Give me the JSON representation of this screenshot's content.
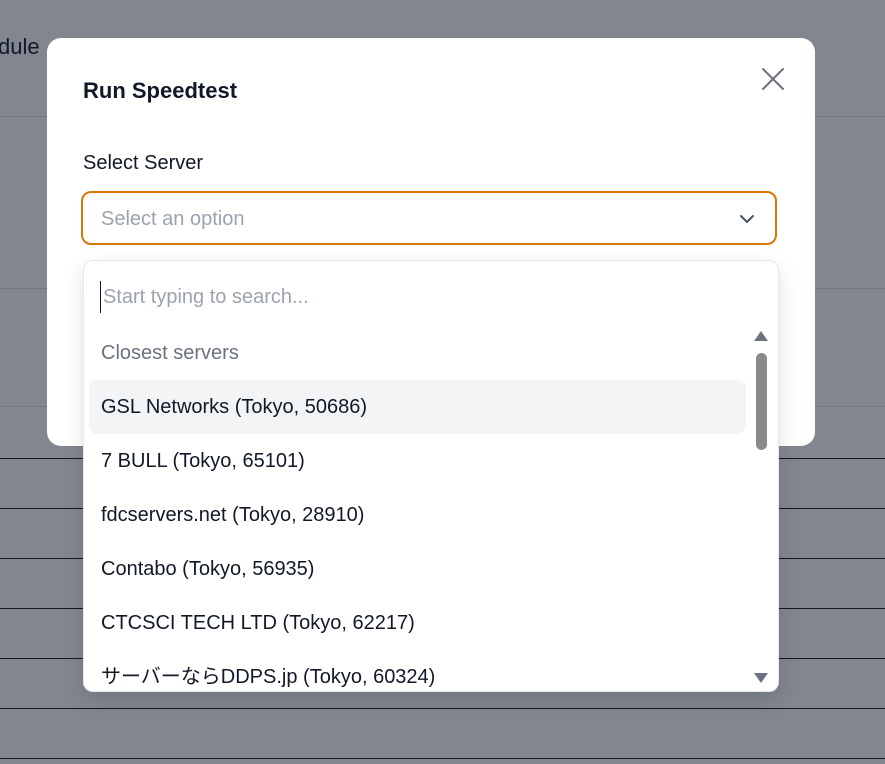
{
  "background": {
    "partial_heading": "dule"
  },
  "modal": {
    "title": "Run Speedtest",
    "close_icon": "close-icon",
    "field_label": "Select Server",
    "select": {
      "placeholder": "Select an option",
      "icon": "chevron-down-icon"
    },
    "dropdown": {
      "search_placeholder": "Start typing to search...",
      "group_label": "Closest servers",
      "options": [
        {
          "label": "GSL Networks (Tokyo, 50686)"
        },
        {
          "label": "7 BULL (Tokyo, 65101)"
        },
        {
          "label": "fdcservers.net (Tokyo, 28910)"
        },
        {
          "label": "Contabo (Tokyo, 56935)"
        },
        {
          "label": "CTCSCI TECH LTD (Tokyo, 62217)"
        },
        {
          "label": "サーバーならDDPS.jp (Tokyo, 60324)"
        }
      ]
    }
  },
  "colors": {
    "accent_border": "#d97706",
    "overlay": "rgba(17,24,39,0.5)"
  }
}
